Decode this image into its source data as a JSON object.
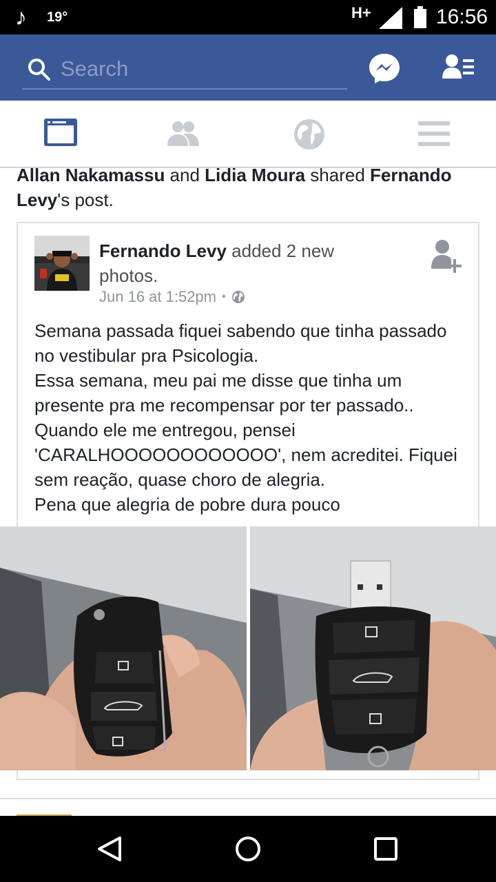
{
  "status_bar": {
    "music_icon": "music-note-icon",
    "temperature": "19°",
    "network": "H+",
    "time": "16:56"
  },
  "search": {
    "placeholder": "Search"
  },
  "tabs": [
    {
      "name": "news-feed",
      "icon": "news-feed-icon",
      "active": true
    },
    {
      "name": "friends",
      "icon": "friends-icon",
      "active": false
    },
    {
      "name": "notifications",
      "icon": "globe-icon",
      "active": false
    },
    {
      "name": "more",
      "icon": "menu-icon",
      "active": false
    }
  ],
  "story": {
    "sharer1": "Allan Nakamassu",
    "and_text": " and ",
    "sharer2": "Lidia Moura",
    "shared_text": " shared ",
    "original_author": "Fernando Levy",
    "post_suffix": "'s post."
  },
  "post": {
    "author": "Fernando Levy",
    "action": " added 2 new photos.",
    "date": "Jun 16 at 1:52pm",
    "privacy_icon": "globe-icon",
    "body": [
      "Semana passada fiquei sabendo que tinha passado no vestibular pra Psicologia.",
      "Essa semana, meu pai me disse que tinha um presente pra me recompensar por ter passado..",
      "Quando ele me entregou, pensei 'CARALHOOOOOOOOOOOO', nem acreditei. Fiquei sem reação, quase choro de alegria.",
      "Pena que alegria de pobre dura pouco"
    ]
  },
  "colors": {
    "brand_blue": "#3b5998",
    "status_bar": "#000000",
    "text_primary": "#1d2129",
    "text_secondary": "#90949c"
  }
}
